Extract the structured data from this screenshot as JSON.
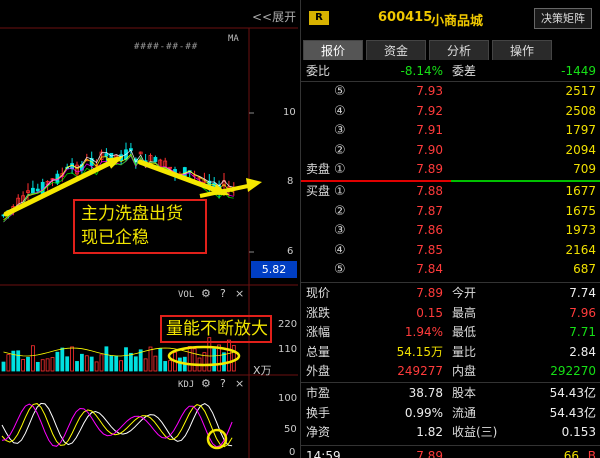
{
  "chart": {
    "expand_label": "<<展开",
    "ma_label": "MA",
    "ma_values": "####-##-##",
    "y_axis": [
      "10",
      "8",
      "6"
    ],
    "current_price_tag": "5.82",
    "annotation_main": [
      "主力洗盘出货",
      "现已企稳"
    ],
    "annotation_vol": "量能不断放大",
    "vol": {
      "title": "VOL",
      "axis": [
        "220",
        "110"
      ],
      "unit": "X万"
    },
    "kdj": {
      "title": "KDJ",
      "axis": [
        "100",
        "50",
        "0"
      ]
    },
    "icon_labels": {
      "gear": "⚙",
      "help": "?",
      "close": "×"
    }
  },
  "header": {
    "badge": "R",
    "code": "600415",
    "name": "小商品城",
    "decision_button": "决策矩阵"
  },
  "tabs": [
    "报价",
    "资金",
    "分析",
    "操作"
  ],
  "quote": {
    "weibi_label": "委比",
    "weibi": "-8.14%",
    "weicha_label": "委差",
    "weicha": "-1449",
    "sell_label": "卖盘",
    "buy_label": "买盘",
    "sells": [
      {
        "idx": "⑤",
        "price": "7.93",
        "vol": "2517"
      },
      {
        "idx": "④",
        "price": "7.92",
        "vol": "2508"
      },
      {
        "idx": "③",
        "price": "7.91",
        "vol": "1797"
      },
      {
        "idx": "②",
        "price": "7.90",
        "vol": "2094"
      },
      {
        "idx": "①",
        "price": "7.89",
        "vol": "709"
      }
    ],
    "buys": [
      {
        "idx": "①",
        "price": "7.88",
        "vol": "1677"
      },
      {
        "idx": "②",
        "price": "7.87",
        "vol": "1675"
      },
      {
        "idx": "③",
        "price": "7.86",
        "vol": "1973"
      },
      {
        "idx": "④",
        "price": "7.85",
        "vol": "2164"
      },
      {
        "idx": "⑤",
        "price": "7.84",
        "vol": "687"
      }
    ],
    "stats": [
      {
        "l1": "现价",
        "v1": "7.89",
        "c1": "red",
        "l2": "今开",
        "v2": "7.74",
        "c2": "white"
      },
      {
        "l1": "涨跌",
        "v1": "0.15",
        "c1": "red",
        "l2": "最高",
        "v2": "7.96",
        "c2": "red"
      },
      {
        "l1": "涨幅",
        "v1": "1.94%",
        "c1": "red",
        "l2": "最低",
        "v2": "7.71",
        "c2": "green"
      },
      {
        "l1": "总量",
        "v1": "54.15万",
        "c1": "yellow",
        "l2": "量比",
        "v2": "2.84",
        "c2": "white"
      },
      {
        "l1": "外盘",
        "v1": "249277",
        "c1": "red",
        "l2": "内盘",
        "v2": "292270",
        "c2": "green"
      }
    ],
    "stats2": [
      {
        "l1": "市盈",
        "v1": "38.78",
        "l2": "股本",
        "v2": "54.43亿"
      },
      {
        "l1": "换手",
        "v1": "0.99%",
        "l2": "流通",
        "v2": "54.43亿"
      },
      {
        "l1": "净资",
        "v1": "1.82",
        "l2": "收益(三)",
        "v2": "0.153"
      }
    ],
    "last_trade": {
      "time": "14:59",
      "price": "7.89",
      "vol": "66",
      "flag": "B"
    }
  }
}
